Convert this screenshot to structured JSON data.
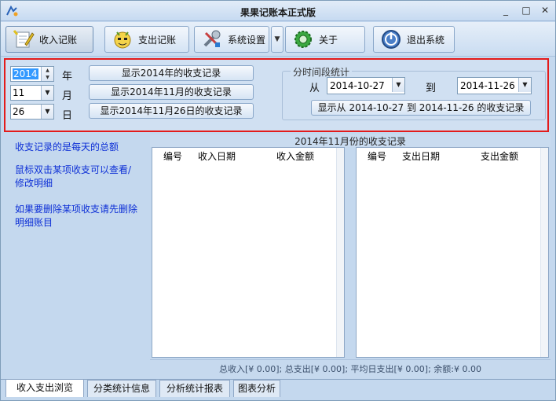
{
  "window": {
    "title": "果果记账本正式版",
    "min_label": "_",
    "max_label": "□",
    "close_label": "✕"
  },
  "toolbar": {
    "income_label": "收入记账",
    "expense_label": "支出记账",
    "settings_label": "系统设置",
    "about_label": "关于",
    "exit_label": "退出系统",
    "dropdown_glyph": "▼"
  },
  "filter": {
    "year_value": "2014",
    "year_label": "年",
    "month_value": "11",
    "month_label": "月",
    "day_value": "26",
    "day_label": "日",
    "show_year_button": "显示2014年的收支记录",
    "show_month_button": "显示2014年11月的收支记录",
    "show_day_button": "显示2014年11月26日的收支记录"
  },
  "range": {
    "group_title": "分时间段统计",
    "from_label": "从",
    "from_value": "2014-10-27",
    "to_label": "到",
    "to_value": "2014-11-26",
    "show_range_button": "显示从 2014-10-27 到 2014-11-26 的收支记录"
  },
  "info": {
    "line1": "收支记录的是每天的总额",
    "line2": "鼠标双击某项收支可以查看/修改明细",
    "line3": "如果要删除某项收支请先删除明细账目"
  },
  "grids": {
    "caption": "2014年11月份的收支记录",
    "income_columns": [
      "编号",
      "收入日期",
      "收入金额"
    ],
    "expense_columns": [
      "编号",
      "支出日期",
      "支出金额"
    ]
  },
  "summary": {
    "text": "总收入[¥ 0.00]; 总支出[¥ 0.00]; 平均日支出[¥ 0.00]; 余额:¥ 0.00"
  },
  "tabs": [
    "收入支出浏览",
    "分类统计信息",
    "分析统计报表",
    "图表分析"
  ],
  "colors": {
    "accent_border": "#e31b1b",
    "info_text": "#0d2fd6",
    "selection": "#3399ff"
  }
}
